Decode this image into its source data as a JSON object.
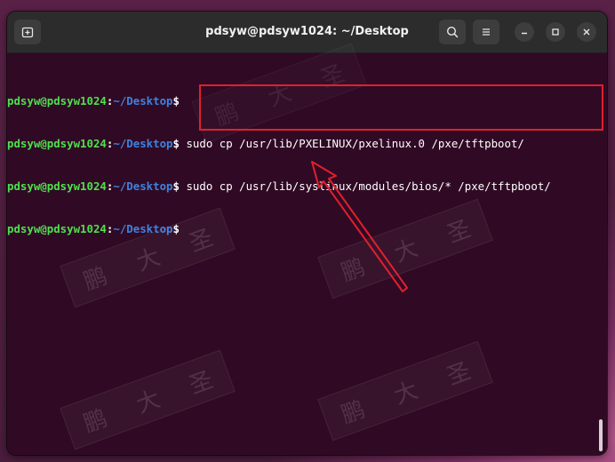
{
  "window": {
    "title": "pdsyw@pdsyw1024: ~/Desktop"
  },
  "prompt": {
    "user_host": "pdsyw@pdsyw1024",
    "colon": ":",
    "path": "~/Desktop",
    "symbol": "$"
  },
  "lines": [
    {
      "command": ""
    },
    {
      "command": " sudo cp /usr/lib/PXELINUX/pxelinux.0 /pxe/tftpboot/"
    },
    {
      "command": " sudo cp /usr/lib/syslinux/modules/bios/* /pxe/tftpboot/"
    },
    {
      "command": ""
    }
  ],
  "watermark": {
    "chars": [
      "鹏",
      "大",
      "圣"
    ]
  },
  "colors": {
    "terminal_bg": "#300a24",
    "prompt_user": "#4ee04e",
    "prompt_path": "#3e82e0",
    "highlight": "#e0202c"
  },
  "icons": {
    "new_tab": "new-tab-icon",
    "search": "search-icon",
    "menu": "hamburger-menu-icon",
    "minimize": "minimize-icon",
    "maximize": "maximize-icon",
    "close": "close-icon"
  }
}
